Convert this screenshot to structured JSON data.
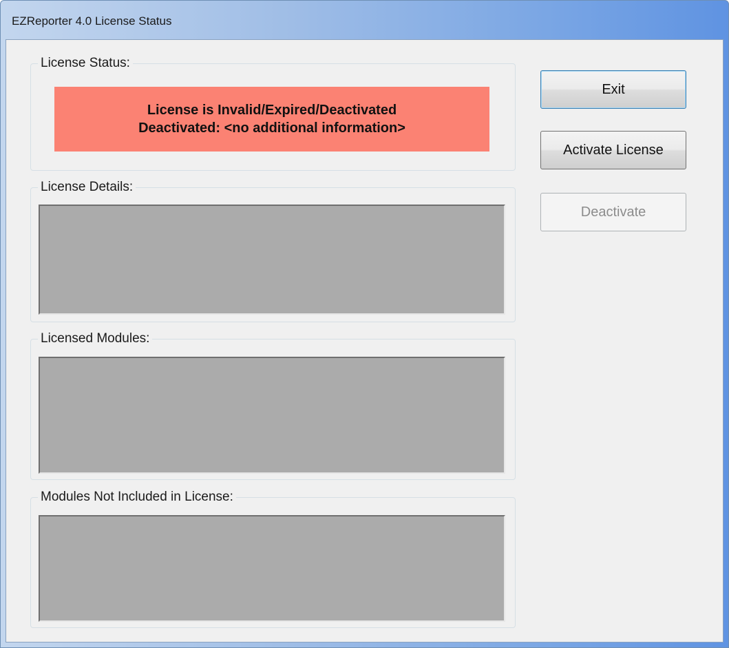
{
  "window": {
    "title": "EZReporter 4.0 License Status"
  },
  "license_status": {
    "label": "License Status:",
    "line1": "License is Invalid/Expired/Deactivated",
    "line2": "Deactivated: <no additional information>",
    "background_color": "#fb8273"
  },
  "license_details": {
    "label": "License Details:"
  },
  "licensed_modules": {
    "label": "Licensed Modules:"
  },
  "modules_not_included": {
    "label": "Modules Not Included in License:"
  },
  "buttons": {
    "exit": "Exit",
    "activate": "Activate License",
    "deactivate": "Deactivate"
  }
}
